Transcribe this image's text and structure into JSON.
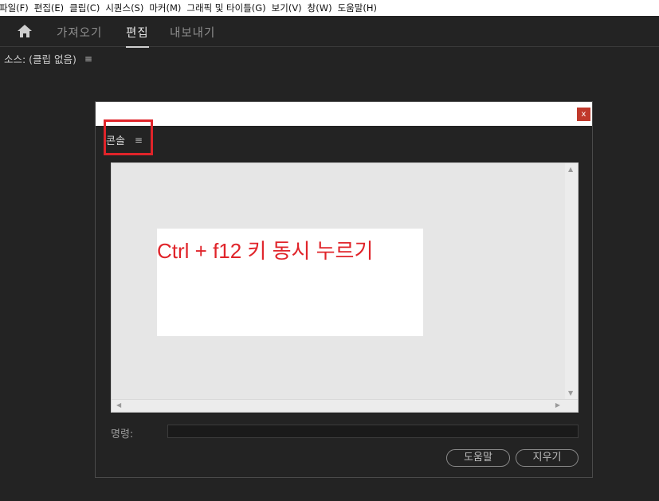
{
  "menu": {
    "items": [
      "파일(F)",
      "편집(E)",
      "클립(C)",
      "시퀀스(S)",
      "마커(M)",
      "그래픽 및 타이틀(G)",
      "보기(V)",
      "창(W)",
      "도움말(H)"
    ]
  },
  "workspace": {
    "home_icon": "home-icon",
    "tabs": [
      "가져오기",
      "편집",
      "내보내기"
    ],
    "active_tab": "편집"
  },
  "source_panel": {
    "title": "소스: (클립 없음)",
    "menu_icon": "≡"
  },
  "console_dialog": {
    "close_label": "x",
    "title": "콘솔",
    "menu_icon": "≡",
    "annotation": "Ctrl + f12 키 동시 누르기",
    "command_label": "명령:",
    "command_value": "",
    "help_button": "도움말",
    "clear_button": "지우기",
    "annotation_color": "#e0242a"
  }
}
